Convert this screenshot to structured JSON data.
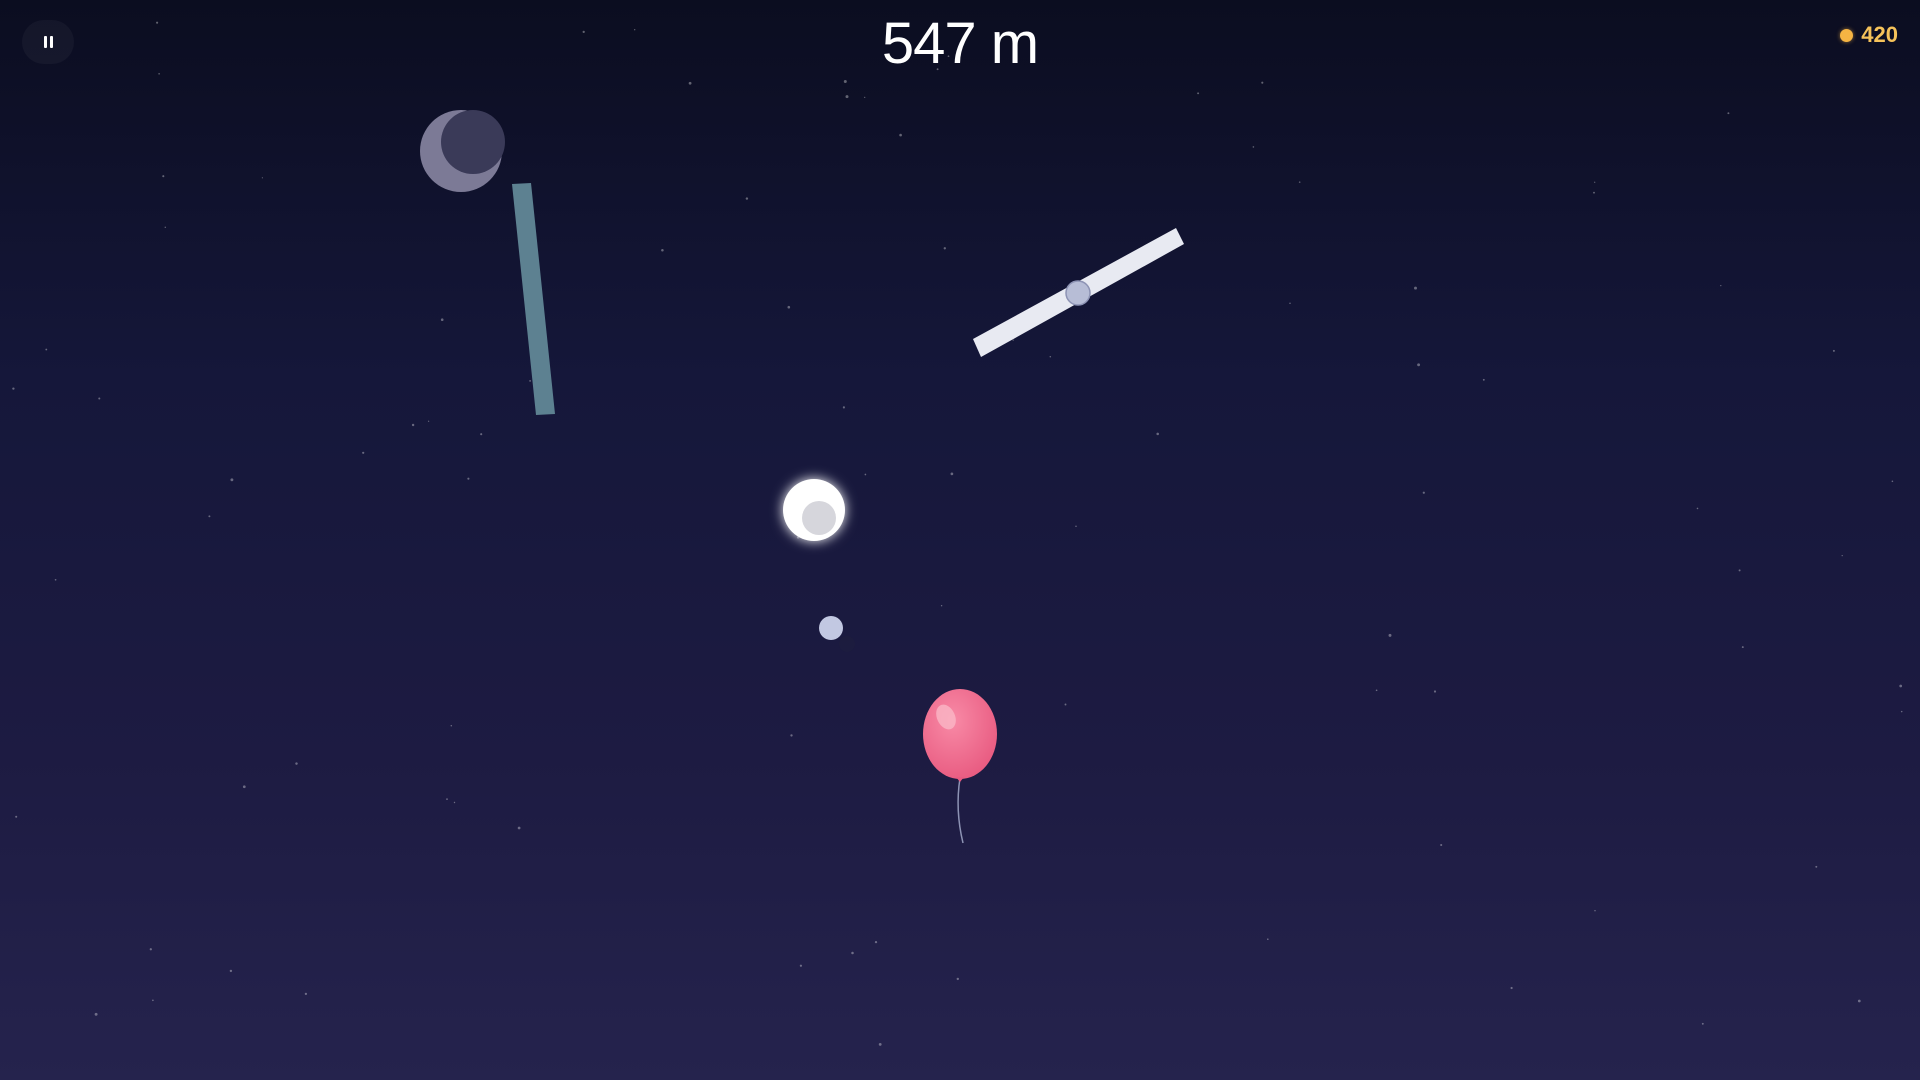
{
  "hud": {
    "distance": "547 m",
    "coins": "420",
    "pause_icon": "pause-icon",
    "coin_icon": "coin-icon"
  },
  "colors": {
    "sky_top": "#0b0d20",
    "sky_bottom": "#25234d",
    "coin": "#f5b443",
    "coin_text": "#f5c25a",
    "balloon": "#f0648a",
    "plank_teal": "#5d8191",
    "plank_white": "#e8eaf2"
  },
  "scene": {
    "objects": [
      "moon-obstacle",
      "teal-plank-obstacle",
      "rotating-white-plank-obstacle",
      "glowing-orb",
      "small-orb",
      "player-balloon"
    ]
  }
}
